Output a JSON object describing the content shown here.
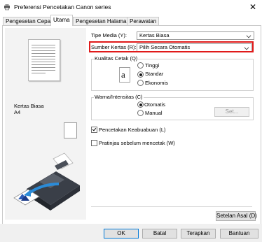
{
  "window": {
    "title": "Preferensi Pencetakan Canon            series",
    "close_symbol": "✕"
  },
  "tabs": [
    {
      "label": "Pengesetan Cepat"
    },
    {
      "label": "Utama"
    },
    {
      "label": "Pengesetan Halaman"
    },
    {
      "label": "Perawatan"
    }
  ],
  "preview": {
    "media_name": "Kertas Biasa",
    "media_size": "A4"
  },
  "settings": {
    "media_type": {
      "label": "Tipe Media (Y):",
      "value": "Kertas Biasa"
    },
    "paper_source": {
      "label": "Sumber Kertas (R):",
      "value": "Pilih Secara Otomatis"
    }
  },
  "quality": {
    "legend": "Kualitas Cetak (Q)",
    "icon_glyph": "a",
    "options": [
      "Tinggi",
      "Standar",
      "Ekonomis"
    ],
    "selected": "Standar"
  },
  "color": {
    "legend": "Warna/Intensitas (C)",
    "options": [
      "Otomatis",
      "Manual"
    ],
    "selected": "Otomatis",
    "set_button": "Set..."
  },
  "checkboxes": {
    "grayscale": {
      "label": "Pencetakan Keabuabuan (L)",
      "checked": true
    },
    "preview": {
      "label": "Pratinjau sebelum mencetak (W)",
      "checked": false
    }
  },
  "defaults_button": "Setelan Asal (D)",
  "dialog_buttons": {
    "ok": "OK",
    "cancel": "Batal",
    "apply": "Terapkan",
    "help": "Bantuan"
  }
}
